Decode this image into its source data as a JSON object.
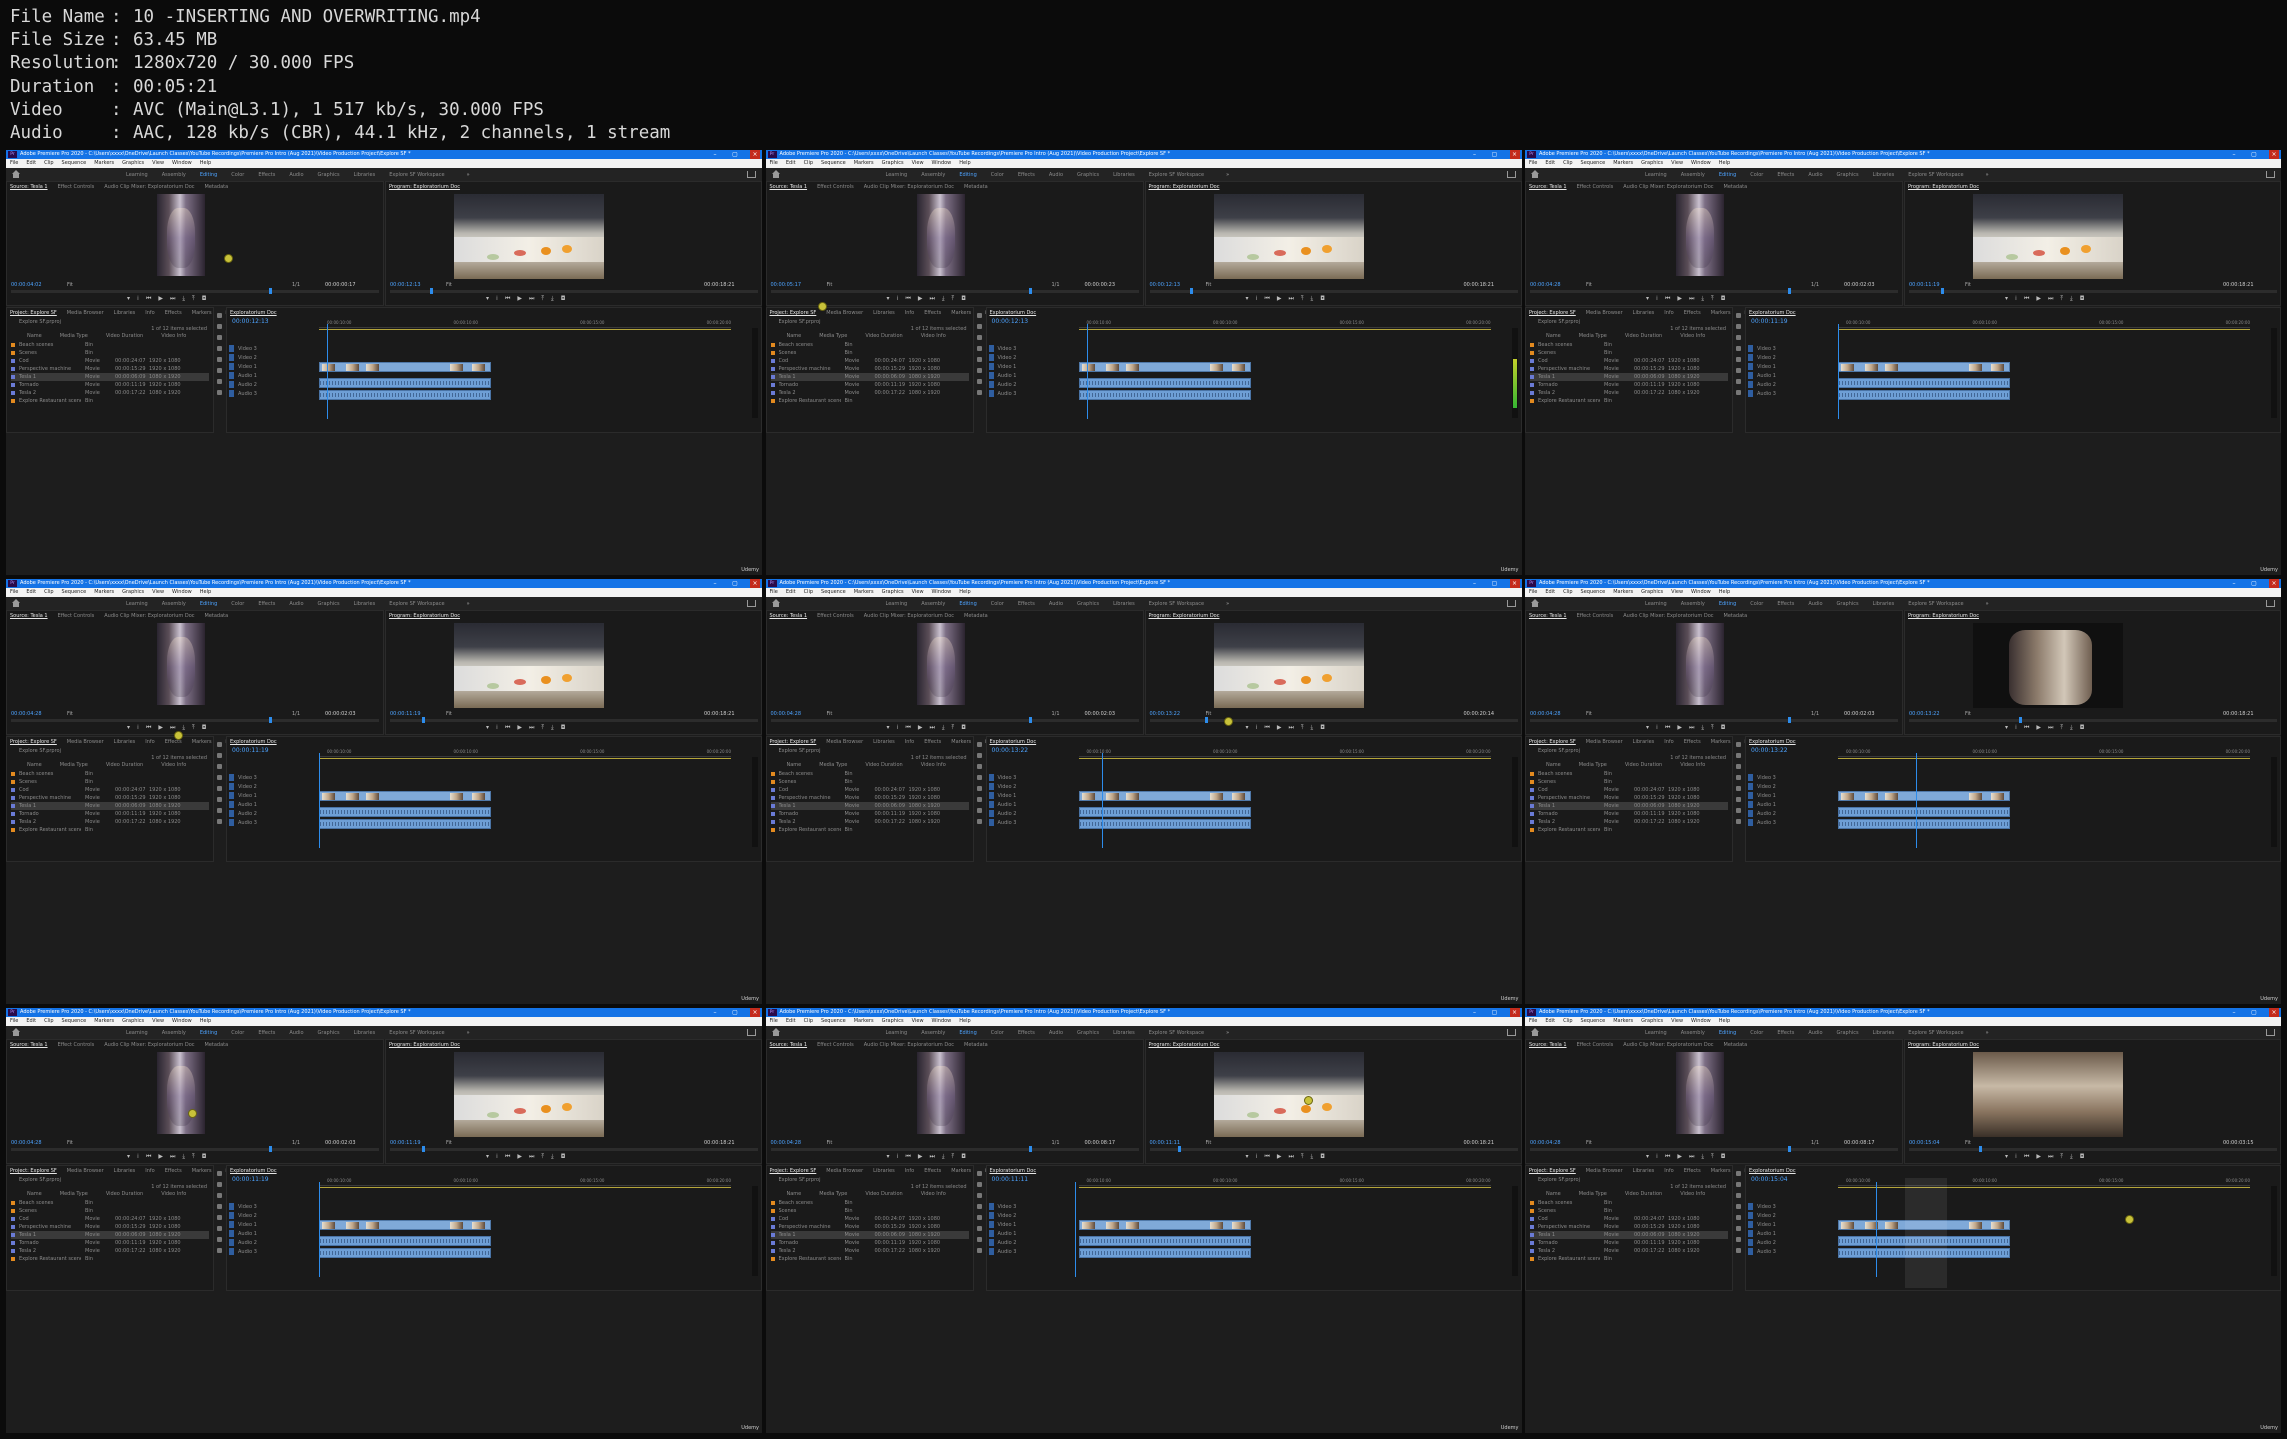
{
  "meta": [
    {
      "key": "File Name",
      "value": "10 -INSERTING AND OVERWRITING.mp4"
    },
    {
      "key": "File Size",
      "value": "63.45 MB"
    },
    {
      "key": "Resolution",
      "value": "1280x720 / 30.000 FPS"
    },
    {
      "key": "Duration",
      "value": "00:05:21"
    },
    {
      "key": "Video",
      "value": "AVC (Main@L3.1), 1 517 kb/s, 30.000 FPS"
    },
    {
      "key": "Audio",
      "value": "AAC, 128 kb/s (CBR), 44.1 kHz, 2 channels, 1 stream"
    }
  ],
  "app": {
    "title": "Adobe Premiere Pro 2020 - C:\\Users\\xxxx\\OneDrive\\Launch Classes\\YouTube Recordings\\Premiere Pro Intro (Aug 2021)\\Video Production Project\\Explore SF *",
    "menus": [
      "File",
      "Edit",
      "Clip",
      "Sequence",
      "Markers",
      "Graphics",
      "View",
      "Window",
      "Help"
    ],
    "workspaces": [
      "Learning",
      "Assembly",
      "Editing",
      "Color",
      "Effects",
      "Audio",
      "Graphics",
      "Libraries",
      "Explore SF Workspace"
    ],
    "workspace_more": "»",
    "source_tabs": [
      "Source: Tesla 1",
      "Effect Controls",
      "Audio Clip Mixer: Exploratorium Doc",
      "Metadata"
    ],
    "program_tab": "Program: Exploratorium Doc",
    "fit_label": "Fit",
    "project_tabs": [
      "Project: Explore SF",
      "Media Browser",
      "Libraries",
      "Info",
      "Effects",
      "Markers",
      "History"
    ],
    "project_file": "Explore SF.prproj",
    "items_selected": "1 of 12 items selected",
    "project_columns": [
      "Name",
      "Media Type",
      "Video Duration",
      "Video Info"
    ],
    "project_rows": [
      {
        "name": "Beach scenes",
        "type": "Bin",
        "dur": "",
        "info": "",
        "color": "#e38a1f"
      },
      {
        "name": "Scenes",
        "type": "Bin",
        "dur": "",
        "info": "",
        "color": "#e38a1f"
      },
      {
        "name": "Cod",
        "type": "Movie",
        "dur": "00:00:24:07",
        "info": "1920 x 1080",
        "color": "#6a7bd6"
      },
      {
        "name": "Perspective machine",
        "type": "Movie",
        "dur": "00:00:15:29",
        "info": "1920 x 1080",
        "color": "#6a7bd6"
      },
      {
        "name": "Tesla 1",
        "type": "Movie",
        "dur": "00:00:06:09",
        "info": "1080 x 1920",
        "color": "#6a7bd6"
      },
      {
        "name": "Tornado",
        "type": "Movie",
        "dur": "00:00:11:19",
        "info": "1920 x 1080",
        "color": "#6a7bd6"
      },
      {
        "name": "Tesla 2",
        "type": "Movie",
        "dur": "00:00:17:22",
        "info": "1080 x 1920",
        "color": "#6a7bd6"
      },
      {
        "name": "Explore Restaurant scene",
        "type": "Bin",
        "dur": "",
        "info": "",
        "color": "#e38a1f"
      }
    ],
    "timeline_tab": "Exploratorium Doc",
    "ruler": [
      "00:00:10:00",
      "00:00:10:00",
      "00:00:15:00",
      "00:00:20:00"
    ],
    "video_tracks": [
      "Video 3",
      "Video 2",
      "Video 1"
    ],
    "audio_tracks": [
      "Audio 1",
      "Audio 2",
      "Audio 3"
    ],
    "watermark": "Udemy",
    "source_duration_label": "1/1"
  },
  "frames": [
    {
      "src_in": "00:00:04:02",
      "src_dur": "00:00:00:17",
      "prog_tc": "00:00:12:13",
      "prog_dur": "00:00:18:21",
      "tl_tc": "00:00:12:13",
      "video": "sushi",
      "vu": false
    },
    {
      "src_in": "00:00:05:17",
      "src_dur": "00:00:00:23",
      "prog_tc": "00:00:12:13",
      "prog_dur": "00:00:18:21",
      "tl_tc": "00:00:12:13",
      "video": "sushi",
      "vu": true
    },
    {
      "src_in": "00:00:04:28",
      "src_dur": "00:00:02:03",
      "prog_tc": "00:00:11:19",
      "prog_dur": "00:00:18:21",
      "tl_tc": "00:00:11:19",
      "video": "plates",
      "vu": false
    },
    {
      "src_in": "00:00:04:28",
      "src_dur": "00:00:02:03",
      "prog_tc": "00:00:11:19",
      "prog_dur": "00:00:18:21",
      "tl_tc": "00:00:11:19",
      "video": "plates",
      "vu": false
    },
    {
      "src_in": "00:00:04:28",
      "src_dur": "00:00:02:03",
      "prog_tc": "00:00:13:22",
      "prog_dur": "00:00:20:14",
      "tl_tc": "00:00:13:22",
      "video": "plates",
      "vu": false
    },
    {
      "src_in": "00:00:04:28",
      "src_dur": "00:00:02:03",
      "prog_tc": "00:00:13:22",
      "prog_dur": "00:00:18:21",
      "tl_tc": "00:00:13:22",
      "video": "glass",
      "vu": false
    },
    {
      "src_in": "00:00:04:28",
      "src_dur": "00:00:02:03",
      "prog_tc": "00:00:11:19",
      "prog_dur": "00:00:18:21",
      "tl_tc": "00:00:11:19",
      "video": "plates",
      "vu": false
    },
    {
      "src_in": "00:00:04:28",
      "src_dur": "00:00:08:17",
      "prog_tc": "00:00:11:11",
      "prog_dur": "00:00:18:21",
      "tl_tc": "00:00:11:11",
      "video": "plates",
      "vu": false
    },
    {
      "src_in": "00:00:04:28",
      "src_dur": "00:00:08:17",
      "prog_tc": "00:00:15:04",
      "prog_dur": "00:00:03:15",
      "tl_tc": "00:00:15:04",
      "video": "crowd",
      "vu": false
    }
  ]
}
